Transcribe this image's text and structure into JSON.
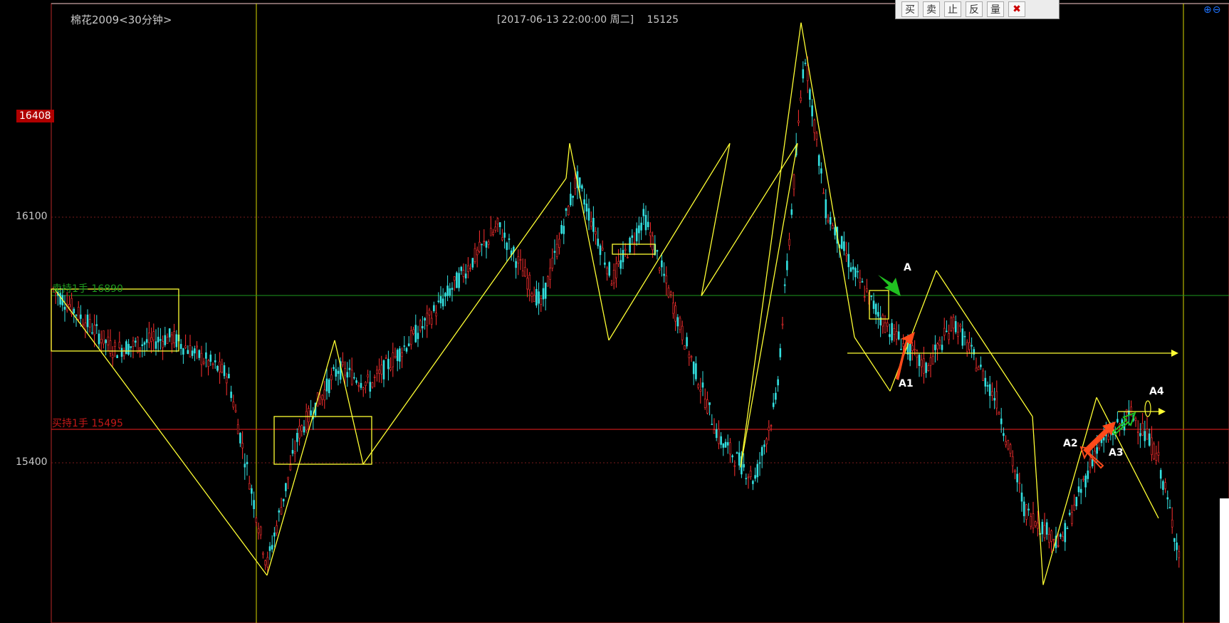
{
  "header": {
    "symbol": "棉花2009<30分钟>",
    "datetime": "[2017-06-13  22:00:00 周二]",
    "price": "15125"
  },
  "y_axis": {
    "labels": [
      "16408",
      "16100",
      "15400"
    ],
    "current_price": "16408"
  },
  "positions": {
    "sell_label": "卖持1手",
    "sell_price": "16890",
    "buy_label": "买持1手",
    "buy_price": "15495"
  },
  "annotations": [
    "A",
    "A1",
    "A2",
    "A3",
    "A4"
  ],
  "toolbar": {
    "buttons": [
      "买",
      "卖",
      "止",
      "反",
      "量"
    ],
    "close_icon": "close-icon"
  },
  "zoom_icons": [
    "zoom-in-icon",
    "zoom-out-icon"
  ],
  "colors": {
    "background": "#000000",
    "candle_up": "#ff3030",
    "candle_down": "#33e0e0",
    "zigzag": "#ffff33",
    "sell_line": "#1e9a1e",
    "buy_line": "#c41818",
    "current_price_badge": "#b00000"
  },
  "chart_data": {
    "type": "candlestick",
    "y_ticks": [
      16100,
      15400
    ],
    "y_range": [
      14900,
      16850
    ],
    "series": [
      {
        "name": "zigzag",
        "values": [
          15950,
          15050,
          15790,
          15400,
          16300,
          16410,
          15790,
          16410,
          15930,
          16410,
          15390,
          16790,
          15800,
          15630,
          16010,
          15550,
          15020,
          15610,
          15230
        ]
      }
    ]
  }
}
